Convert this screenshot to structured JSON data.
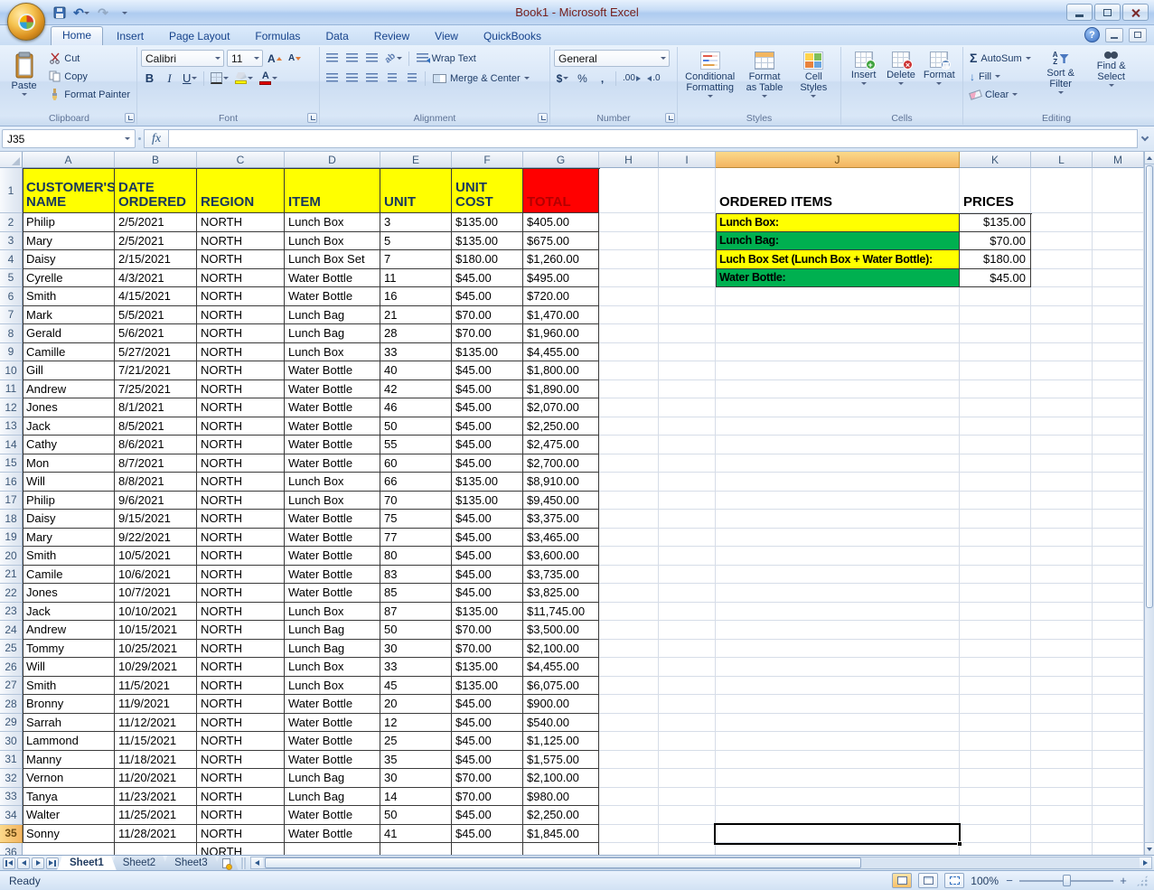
{
  "window": {
    "title": "Book1 - Microsoft Excel"
  },
  "icons": {
    "quick_access": [
      "office-button-icon",
      "save-icon",
      "undo-icon",
      "redo-icon",
      "qat-customize-icon"
    ],
    "window_controls": [
      "minimize-icon",
      "restore-icon",
      "close-icon"
    ],
    "tab_row_controls": [
      "help-icon",
      "window-minimize-icon",
      "window-restore-icon"
    ]
  },
  "ribbon": {
    "tabs": [
      "Home",
      "Insert",
      "Page Layout",
      "Formulas",
      "Data",
      "Review",
      "View",
      "QuickBooks"
    ],
    "active_tab": "Home",
    "clipboard": {
      "label": "Clipboard",
      "paste": "Paste",
      "cut": "Cut",
      "copy": "Copy",
      "format_painter": "Format Painter"
    },
    "font": {
      "label": "Font",
      "font_name": "Calibri",
      "font_size": "11",
      "bold": "B",
      "italic": "I",
      "underline": "U"
    },
    "alignment": {
      "label": "Alignment",
      "wrap_text": "Wrap Text",
      "merge_center": "Merge & Center",
      "orientation": "ab"
    },
    "number": {
      "label": "Number",
      "format": "General",
      "currency": "$",
      "percent": "%",
      "comma": ",",
      "inc_decimal": ".00",
      "dec_decimal": ".0"
    },
    "styles": {
      "label": "Styles",
      "conditional": "Conditional Formatting",
      "format_table": "Format as Table",
      "cell_styles": "Cell Styles"
    },
    "cells": {
      "label": "Cells",
      "insert": "Insert",
      "delete": "Delete",
      "format": "Format"
    },
    "editing": {
      "label": "Editing",
      "sigma": "Σ",
      "autosum": "AutoSum",
      "fill": "Fill",
      "clear": "Clear",
      "sort_filter": "Sort & Filter",
      "find_select": "Find & Select"
    }
  },
  "formula_bar": {
    "name_box": "J35",
    "fx_label": "fx",
    "formula": ""
  },
  "grid": {
    "col_headers": [
      "A",
      "B",
      "C",
      "D",
      "E",
      "F",
      "G",
      "H",
      "I",
      "J",
      "K",
      "L",
      "M"
    ],
    "selected": {
      "cell": "J35",
      "col": "J",
      "row": 35
    },
    "main_table": {
      "headers": [
        "CUSTOMER'S NAME",
        "DATE ORDERED",
        "REGION",
        "ITEM",
        "UNIT",
        "UNIT COST",
        "TOTAL"
      ],
      "header_bg": "#ffff00",
      "header_text": "#17375d",
      "total_bg": "#ff0000",
      "total_text": "#b30000",
      "rows": [
        [
          "Philip",
          "2/5/2021",
          "NORTH",
          "Lunch Box",
          "3",
          "$135.00",
          "$405.00"
        ],
        [
          "Mary",
          "2/5/2021",
          "NORTH",
          "Lunch Box",
          "5",
          "$135.00",
          "$675.00"
        ],
        [
          "Daisy",
          "2/15/2021",
          "NORTH",
          "Lunch Box Set",
          "7",
          "$180.00",
          "$1,260.00"
        ],
        [
          "Cyrelle",
          "4/3/2021",
          "NORTH",
          "Water Bottle",
          "11",
          "$45.00",
          "$495.00"
        ],
        [
          "Smith",
          "4/15/2021",
          "NORTH",
          "Water Bottle",
          "16",
          "$45.00",
          "$720.00"
        ],
        [
          "Mark",
          "5/5/2021",
          "NORTH",
          "Lunch Bag",
          "21",
          "$70.00",
          "$1,470.00"
        ],
        [
          "Gerald",
          "5/6/2021",
          "NORTH",
          "Lunch Bag",
          "28",
          "$70.00",
          "$1,960.00"
        ],
        [
          "Camille",
          "5/27/2021",
          "NORTH",
          "Lunch Box",
          "33",
          "$135.00",
          "$4,455.00"
        ],
        [
          "Gill",
          "7/21/2021",
          "NORTH",
          "Water Bottle",
          "40",
          "$45.00",
          "$1,800.00"
        ],
        [
          "Andrew",
          "7/25/2021",
          "NORTH",
          "Water Bottle",
          "42",
          "$45.00",
          "$1,890.00"
        ],
        [
          "Jones",
          "8/1/2021",
          "NORTH",
          "Water Bottle",
          "46",
          "$45.00",
          "$2,070.00"
        ],
        [
          "Jack",
          "8/5/2021",
          "NORTH",
          "Water Bottle",
          "50",
          "$45.00",
          "$2,250.00"
        ],
        [
          "Cathy",
          "8/6/2021",
          "NORTH",
          "Water Bottle",
          "55",
          "$45.00",
          "$2,475.00"
        ],
        [
          "Mon",
          "8/7/2021",
          "NORTH",
          "Water Bottle",
          "60",
          "$45.00",
          "$2,700.00"
        ],
        [
          "Will",
          "8/8/2021",
          "NORTH",
          "Lunch Box",
          "66",
          "$135.00",
          "$8,910.00"
        ],
        [
          "Philip",
          "9/6/2021",
          "NORTH",
          "Lunch Box",
          "70",
          "$135.00",
          "$9,450.00"
        ],
        [
          "Daisy",
          "9/15/2021",
          "NORTH",
          "Water Bottle",
          "75",
          "$45.00",
          "$3,375.00"
        ],
        [
          "Mary",
          "9/22/2021",
          "NORTH",
          "Water Bottle",
          "77",
          "$45.00",
          "$3,465.00"
        ],
        [
          "Smith",
          "10/5/2021",
          "NORTH",
          "Water Bottle",
          "80",
          "$45.00",
          "$3,600.00"
        ],
        [
          "Camile",
          "10/6/2021",
          "NORTH",
          "Water Bottle",
          "83",
          "$45.00",
          "$3,735.00"
        ],
        [
          "Jones",
          "10/7/2021",
          "NORTH",
          "Water Bottle",
          "85",
          "$45.00",
          "$3,825.00"
        ],
        [
          "Jack",
          "10/10/2021",
          "NORTH",
          "Lunch Box",
          "87",
          "$135.00",
          "$11,745.00"
        ],
        [
          "Andrew",
          "10/15/2021",
          "NORTH",
          "Lunch Bag",
          "50",
          "$70.00",
          "$3,500.00"
        ],
        [
          "Tommy",
          "10/25/2021",
          "NORTH",
          "Lunch Bag",
          "30",
          "$70.00",
          "$2,100.00"
        ],
        [
          "Will",
          "10/29/2021",
          "NORTH",
          "Lunch Box",
          "33",
          "$135.00",
          "$4,455.00"
        ],
        [
          "Smith",
          "11/5/2021",
          "NORTH",
          "Lunch Box",
          "45",
          "$135.00",
          "$6,075.00"
        ],
        [
          "Bronny",
          "11/9/2021",
          "NORTH",
          "Water Bottle",
          "20",
          "$45.00",
          "$900.00"
        ],
        [
          "Sarrah",
          "11/12/2021",
          "NORTH",
          "Water Bottle",
          "12",
          "$45.00",
          "$540.00"
        ],
        [
          "Lammond",
          "11/15/2021",
          "NORTH",
          "Water Bottle",
          "25",
          "$45.00",
          "$1,125.00"
        ],
        [
          "Manny",
          "11/18/2021",
          "NORTH",
          "Water Bottle",
          "35",
          "$45.00",
          "$1,575.00"
        ],
        [
          "Vernon",
          "11/20/2021",
          "NORTH",
          "Lunch Bag",
          "30",
          "$70.00",
          "$2,100.00"
        ],
        [
          "Tanya",
          "11/23/2021",
          "NORTH",
          "Lunch Bag",
          "14",
          "$70.00",
          "$980.00"
        ],
        [
          "Walter",
          "11/25/2021",
          "NORTH",
          "Water Bottle",
          "50",
          "$45.00",
          "$2,250.00"
        ],
        [
          "Sonny",
          "11/28/2021",
          "NORTH",
          "Water Bottle",
          "41",
          "$45.00",
          "$1,845.00"
        ]
      ],
      "partial_row_36": [
        "",
        "",
        "NORTH",
        "",
        "",
        "",
        ""
      ]
    },
    "side_table": {
      "title": "ORDERED ITEMS",
      "price_title": "PRICES",
      "items": [
        {
          "label": "Lunch Box:",
          "price": "$135.00",
          "bg": "#ffff00"
        },
        {
          "label": "Lunch Bag:",
          "price": "$70.00",
          "bg": "#00b050"
        },
        {
          "label": "Luch Box Set (Lunch Box + Water Bottle):",
          "price": "$180.00",
          "bg": "#ffff00"
        },
        {
          "label": "Water Bottle:",
          "price": "$45.00",
          "bg": "#00b050"
        }
      ]
    }
  },
  "sheet_tabs": {
    "tabs": [
      "Sheet1",
      "Sheet2",
      "Sheet3"
    ],
    "active": "Sheet1"
  },
  "status_bar": {
    "mode": "Ready",
    "zoom": "100%"
  }
}
